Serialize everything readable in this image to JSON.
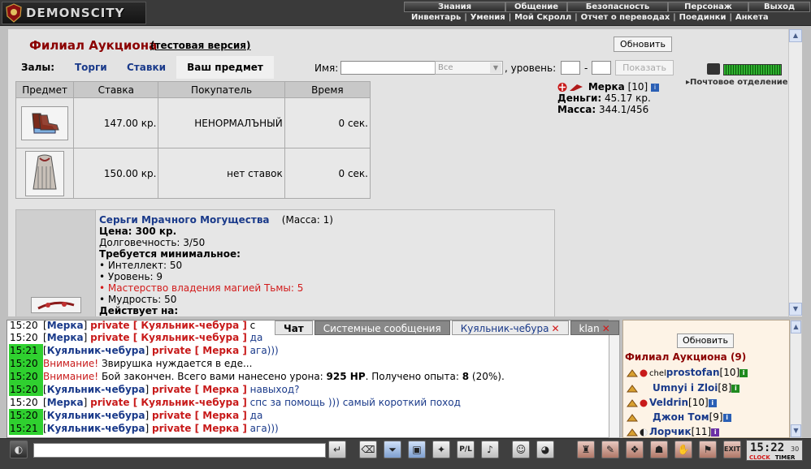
{
  "app": {
    "logo_text": "DEMONSCITY"
  },
  "menu_top": [
    "Знания",
    "Общение",
    "Безопасность",
    "Персонаж",
    "Выход"
  ],
  "menu_sub": [
    "Инвентарь",
    "Умения",
    "Мой Скролл",
    "Отчет о переводах",
    "Поединки",
    "Анкета"
  ],
  "page": {
    "title": "Филиал Аукциона",
    "subtitle": "(тестовая версия)",
    "refresh": "Обновить"
  },
  "halls": {
    "label": "Залы:",
    "tabs": [
      "Торги",
      "Ставки"
    ],
    "active": "Ваш предмет"
  },
  "filter": {
    "name_label": "Имя:",
    "select_value": "Все",
    "level_label": ", уровень:",
    "dash": "-",
    "show": "Показать"
  },
  "table": {
    "headers": [
      "Предмет",
      "Ставка",
      "Покупатель",
      "Время"
    ],
    "rows": [
      {
        "bid": "147.00 кр.",
        "buyer": "НЕНОРМАЛЪНЫЙ",
        "time": "0 сек."
      },
      {
        "bid": "150.00 кр.",
        "buyer": "нет ставок",
        "time": "0 сек."
      }
    ]
  },
  "item": {
    "name": "Серьги Мрачного Могущества",
    "mass": "(Масса: 1)",
    "price": "Цена: 300 кр.",
    "durability": "Долговечность: 3/50",
    "req_title": "Требуется минимальное:",
    "req_int": "• Интеллект: 50",
    "req_lvl": "• Уровень: 9",
    "req_magic": "• Мастерство владения магией Тьмы: 5",
    "req_wis": "• Мудрость: 50",
    "effects": "Действует на:"
  },
  "character": {
    "name": "Мерка",
    "level": "[10]",
    "money_label": "Деньги:",
    "money": "45.17 кр.",
    "mass_label": "Масса:",
    "mass": "344.1/456"
  },
  "side": {
    "mail": "Почтовое отделение"
  },
  "tabs": [
    {
      "label": "Чат"
    },
    {
      "label": "Системные сообщения"
    },
    {
      "label": "Куяльник-чебура",
      "close": "✕"
    },
    {
      "label": "klan",
      "close": "✕"
    }
  ],
  "chat": [
    {
      "time": "15:20",
      "green": false,
      "pre": "[",
      "user": "Мерка",
      "mid": "] ",
      "pv": "private [ Куяльник-чебура ]",
      "text": " с"
    },
    {
      "time": "15:20",
      "green": false,
      "pre": "[",
      "user": "Мерка",
      "mid": "] ",
      "pv": "private [ Куяльник-чебура ]",
      "text": " да"
    },
    {
      "time": "15:21",
      "green": true,
      "pre": "[",
      "user": "Куяльник-чебура",
      "mid": "] ",
      "pv": "private [ Мерка ]",
      "text": " ага)))"
    },
    {
      "time": "15:20",
      "green": true,
      "warn": "Внимание!",
      "text": " Звирушка нуждается в еде..."
    },
    {
      "time": "15:20",
      "green": true,
      "warn": "Внимание!",
      "text": " Бой закончен. Всего вами нанесено урона: ",
      "b1": "925 HP",
      "t2": ". Получено опыта: ",
      "b2": "8",
      "t3": " (20%)."
    },
    {
      "time": "15:20",
      "green": true,
      "pre": "[",
      "user": "Куяльник-чебура",
      "mid": "] ",
      "pv": "private [ Мерка ]",
      "text": " навыход?"
    },
    {
      "time": "15:20",
      "green": false,
      "pre": "[",
      "user": "Мерка",
      "mid": "] ",
      "pv": "private [ Куяльник-чебура ]",
      "text": " спс за помощь ))) самый короткий поход"
    },
    {
      "time": "15:20",
      "green": true,
      "pre": "[",
      "user": "Куяльник-чебура",
      "mid": "] ",
      "pv": "private [ Мерка ]",
      "text": " да"
    },
    {
      "time": "15:21",
      "green": true,
      "pre": "[",
      "user": "Куяльник-чебура",
      "mid": "] ",
      "pv": "private [ Мерка ]",
      "text": " ага)))"
    }
  ],
  "online": {
    "refresh": "Обновить",
    "title": "Филиал Аукциона (9)",
    "users": [
      {
        "tag": "chel",
        "name": "prostofan",
        "level": "[10]"
      },
      {
        "tag": "",
        "name": "Umnyi i Zloi",
        "level": "[8]"
      },
      {
        "tag": "",
        "name": "Veldrin",
        "level": "[10]"
      },
      {
        "tag": "",
        "name": "Джон Том",
        "level": "[9]"
      },
      {
        "tag": "",
        "name": "Лорчик",
        "level": "[11]"
      }
    ]
  },
  "clock": {
    "time": "15:22",
    "sec": "30",
    "clock_label": "CLOCK",
    "timer_label": "TIMER"
  },
  "colors": {
    "title": "#8b0000",
    "link": "#1a3a8a",
    "private": "#c81a1a",
    "timestamp_green": "#2fd02f"
  }
}
